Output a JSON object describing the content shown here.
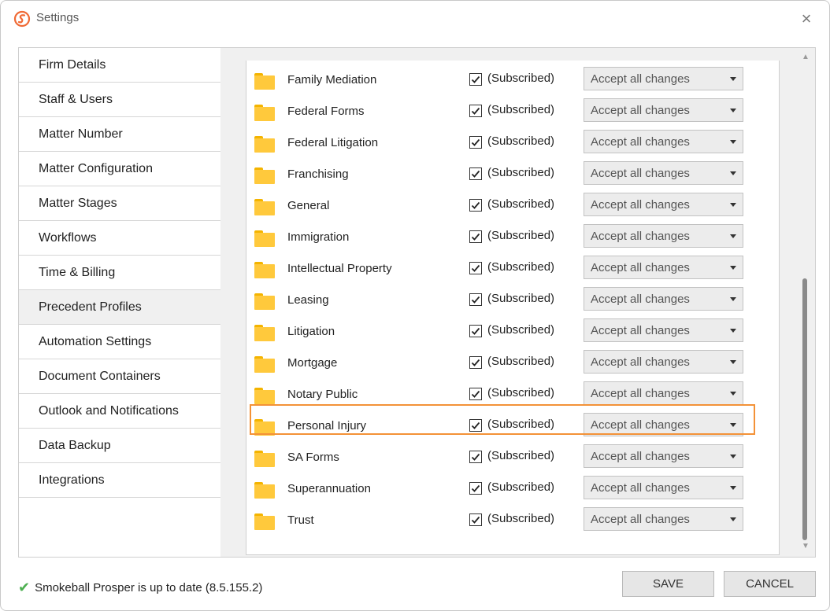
{
  "window": {
    "title": "Settings",
    "close_icon": "×"
  },
  "sidebar": {
    "items": [
      {
        "label": "Firm Details"
      },
      {
        "label": "Staff & Users"
      },
      {
        "label": "Matter Number"
      },
      {
        "label": "Matter Configuration"
      },
      {
        "label": "Matter Stages"
      },
      {
        "label": "Workflows"
      },
      {
        "label": "Time & Billing"
      },
      {
        "label": "Precedent Profiles",
        "active": true
      },
      {
        "label": "Automation Settings"
      },
      {
        "label": "Document Containers"
      },
      {
        "label": "Outlook and Notifications"
      },
      {
        "label": "Data Backup"
      },
      {
        "label": "Integrations"
      }
    ]
  },
  "profiles": {
    "subscribed_label": "(Subscribed)",
    "option_label": "Accept all changes",
    "rows": [
      {
        "name": "Family Mediation"
      },
      {
        "name": "Federal Forms"
      },
      {
        "name": "Federal Litigation"
      },
      {
        "name": "Franchising"
      },
      {
        "name": "General"
      },
      {
        "name": "Immigration"
      },
      {
        "name": "Intellectual Property"
      },
      {
        "name": "Leasing"
      },
      {
        "name": "Litigation"
      },
      {
        "name": "Mortgage"
      },
      {
        "name": "Notary Public"
      },
      {
        "name": "Personal Injury",
        "highlighted": true
      },
      {
        "name": "SA Forms"
      },
      {
        "name": "Superannuation"
      },
      {
        "name": "Trust"
      }
    ]
  },
  "footer": {
    "status": "Smokeball Prosper is up to date (8.5.155.2)",
    "save_label": "SAVE",
    "cancel_label": "CANCEL"
  },
  "colors": {
    "highlight": "#f39237",
    "check": "#4caf50",
    "folder": "#ffc93c"
  }
}
